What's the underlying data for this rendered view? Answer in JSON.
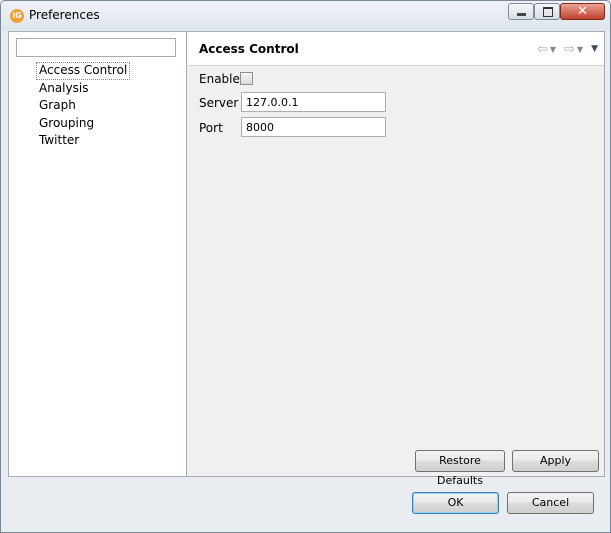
{
  "window": {
    "title": "Preferences",
    "icon": "preferences-app-icon",
    "controls": [
      "minimize",
      "maximize",
      "close"
    ]
  },
  "sidebar": {
    "filter_value": "",
    "items": [
      {
        "label": "Access Control",
        "selected": true
      },
      {
        "label": "Analysis",
        "selected": false
      },
      {
        "label": "Graph",
        "selected": false
      },
      {
        "label": "Grouping",
        "selected": false
      },
      {
        "label": "Twitter",
        "selected": false
      }
    ]
  },
  "page": {
    "title": "Access Control",
    "enable_label": "Enable",
    "enable_checked": false,
    "server_label": "Server",
    "server_value": "127.0.0.1",
    "port_label": "Port",
    "port_value": "8000",
    "restore_defaults_label": "Restore Defaults",
    "apply_label": "Apply"
  },
  "footer": {
    "ok_label": "OK",
    "cancel_label": "Cancel"
  }
}
